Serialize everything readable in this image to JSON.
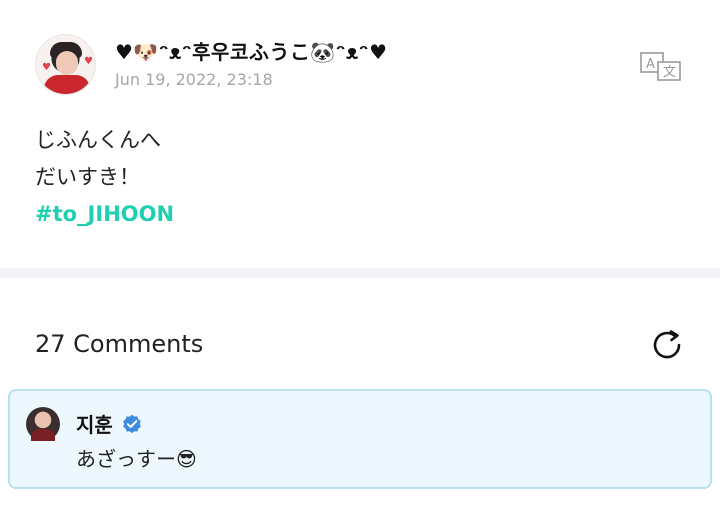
{
  "post": {
    "author": "♥🐶ᵔᴥᵔ후우코ふうこ🐼ᵔᴥᵔ♥",
    "timestamp": "Jun 19, 2022, 23:18",
    "content_lines": [
      "じふんくんへ",
      "だいすき！"
    ],
    "hashtag": "#to_JIHOON",
    "translate_icon": "translate-icon"
  },
  "comments": {
    "header": "27 Comments",
    "refresh_icon": "refresh-icon",
    "items": [
      {
        "name": "지훈",
        "text": "あざっすー😎",
        "verified": true
      }
    ]
  },
  "colors": {
    "hashtag": "#1fcfb1",
    "divider": "#f4f4f8",
    "comment_bg": "#ecf8fd",
    "comment_border": "#b8e2ee",
    "verified": "#3d8be0"
  }
}
